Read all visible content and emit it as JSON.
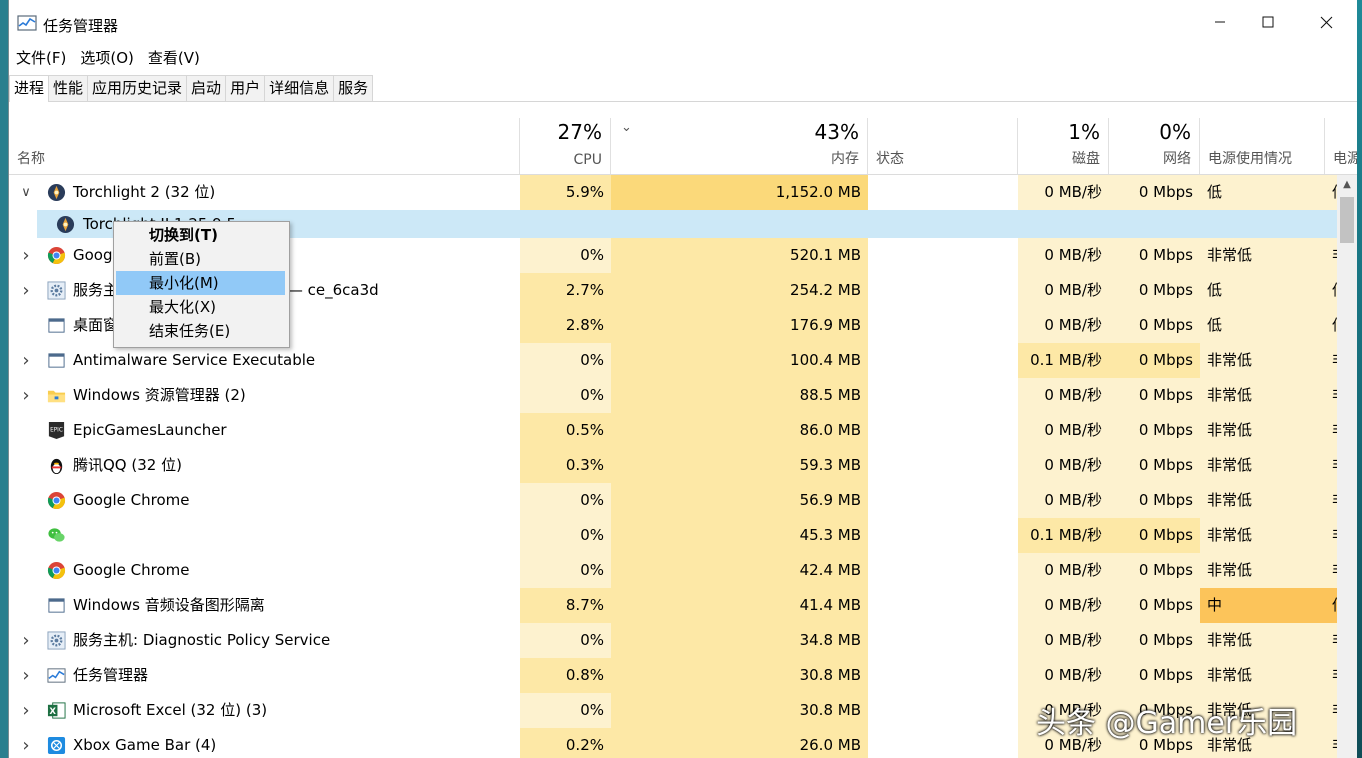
{
  "window": {
    "title": "任务管理器"
  },
  "menu": [
    "文件(F)",
    "选项(O)",
    "查看(V)"
  ],
  "tabs": [
    "进程",
    "性能",
    "应用历史记录",
    "启动",
    "用户",
    "详细信息",
    "服务"
  ],
  "columns": {
    "name": "名称",
    "cpu": {
      "pct": "27%",
      "label": "CPU"
    },
    "mem": {
      "pct": "43%",
      "label": "内存"
    },
    "status": "状态",
    "disk": {
      "pct": "1%",
      "label": "磁盘"
    },
    "net": {
      "pct": "0%",
      "label": "网络"
    },
    "power": "电源使用情况",
    "power_trend": "电源"
  },
  "processes": [
    {
      "name": "Torchlight 2 (32 位)",
      "cpu": "5.9%",
      "mem": "1,152.0 MB",
      "disk": "0 MB/秒",
      "net": "0 Mbps",
      "power": "低",
      "trend": "低",
      "icon": "torchlight-icon",
      "expand": "v",
      "color_cpu": "#fde8a6",
      "color_mem": "#fbd97a",
      "color_disk": "#fdf2cf",
      "color_power": "#fdf2cf"
    },
    {
      "name": "Torchlight II 1.25.9.5",
      "cpu": "",
      "mem": "",
      "disk": "",
      "net": "",
      "power": "",
      "trend": "",
      "icon": "torchlight-icon",
      "expand": "",
      "child": true,
      "selected": true
    },
    {
      "name": "Google Chrome",
      "cpu": "0%",
      "mem": "520.1 MB",
      "disk": "0 MB/秒",
      "net": "0 Mbps",
      "power": "非常低",
      "trend": "非常低",
      "icon": "chrome-icon",
      "expand": ">",
      "color_cpu": "#fdf2cf",
      "color_mem": "#fde8a6",
      "color_disk": "#fdf2cf",
      "color_power": "#fdf2cf"
    },
    {
      "name": "服务主机: Unistack 服务组 (3) — ce_6ca3d",
      "cpu": "2.7%",
      "mem": "254.2 MB",
      "disk": "0 MB/秒",
      "net": "0 Mbps",
      "power": "低",
      "trend": "低",
      "icon": "gear-service-icon",
      "expand": ">",
      "color_cpu": "#fde8a6",
      "color_mem": "#fde8a6",
      "color_disk": "#fdf2cf",
      "color_power": "#fdf2cf"
    },
    {
      "name": "桌面窗口管理器",
      "cpu": "2.8%",
      "mem": "176.9 MB",
      "disk": "0 MB/秒",
      "net": "0 Mbps",
      "power": "低",
      "trend": "低",
      "icon": "window-app-icon",
      "expand": "",
      "color_cpu": "#fde8a6",
      "color_mem": "#fde8a6",
      "color_disk": "#fdf2cf",
      "color_power": "#fdf2cf"
    },
    {
      "name": "Antimalware Service Executable",
      "cpu": "0%",
      "mem": "100.4 MB",
      "disk": "0.1 MB/秒",
      "net": "0 Mbps",
      "power": "非常低",
      "trend": "非常低",
      "icon": "window-app-icon",
      "expand": ">",
      "color_cpu": "#fdf2cf",
      "color_mem": "#fde8a6",
      "color_disk": "#fde8a6",
      "color_power": "#fdf2cf"
    },
    {
      "name": "Windows 资源管理器 (2)",
      "cpu": "0%",
      "mem": "88.5 MB",
      "disk": "0 MB/秒",
      "net": "0 Mbps",
      "power": "非常低",
      "trend": "非常低",
      "icon": "folder-icon",
      "expand": ">",
      "color_cpu": "#fdf2cf",
      "color_mem": "#fde8a6",
      "color_disk": "#fdf2cf",
      "color_power": "#fdf2cf"
    },
    {
      "name": "EpicGamesLauncher",
      "cpu": "0.5%",
      "mem": "86.0 MB",
      "disk": "0 MB/秒",
      "net": "0 Mbps",
      "power": "非常低",
      "trend": "非常低",
      "icon": "epic-icon",
      "expand": "",
      "color_cpu": "#fde8a6",
      "color_mem": "#fde8a6",
      "color_disk": "#fdf2cf",
      "color_power": "#fdf2cf"
    },
    {
      "name": "腾讯QQ (32 位)",
      "cpu": "0.3%",
      "mem": "59.3 MB",
      "disk": "0 MB/秒",
      "net": "0 Mbps",
      "power": "非常低",
      "trend": "非常低",
      "icon": "qq-penguin-icon",
      "expand": "",
      "color_cpu": "#fde8a6",
      "color_mem": "#fde8a6",
      "color_disk": "#fdf2cf",
      "color_power": "#fdf2cf"
    },
    {
      "name": "Google Chrome",
      "cpu": "0%",
      "mem": "56.9 MB",
      "disk": "0 MB/秒",
      "net": "0 Mbps",
      "power": "非常低",
      "trend": "非常低",
      "icon": "chrome-icon",
      "expand": "",
      "color_cpu": "#fdf2cf",
      "color_mem": "#fde8a6",
      "color_disk": "#fdf2cf",
      "color_power": "#fdf2cf"
    },
    {
      "name": "",
      "cpu": "0%",
      "mem": "45.3 MB",
      "disk": "0.1 MB/秒",
      "net": "0 Mbps",
      "power": "非常低",
      "trend": "非常低",
      "icon": "wechat-icon",
      "expand": "",
      "color_cpu": "#fdf2cf",
      "color_mem": "#fde8a6",
      "color_disk": "#fde8a6",
      "color_power": "#fdf2cf"
    },
    {
      "name": "Google Chrome",
      "cpu": "0%",
      "mem": "42.4 MB",
      "disk": "0 MB/秒",
      "net": "0 Mbps",
      "power": "非常低",
      "trend": "非常低",
      "icon": "chrome-icon",
      "expand": "",
      "color_cpu": "#fdf2cf",
      "color_mem": "#fde8a6",
      "color_disk": "#fdf2cf",
      "color_power": "#fdf2cf"
    },
    {
      "name": "Windows 音频设备图形隔离",
      "cpu": "8.7%",
      "mem": "41.4 MB",
      "disk": "0 MB/秒",
      "net": "0 Mbps",
      "power": "中",
      "trend": "低",
      "icon": "window-app-icon",
      "expand": "",
      "color_cpu": "#fde8a6",
      "color_mem": "#fde8a6",
      "color_disk": "#fdf2cf",
      "color_power": "#fcc45a"
    },
    {
      "name": "服务主机: Diagnostic Policy Service",
      "cpu": "0%",
      "mem": "34.8 MB",
      "disk": "0 MB/秒",
      "net": "0 Mbps",
      "power": "非常低",
      "trend": "非常低",
      "icon": "gear-service-icon",
      "expand": ">",
      "color_cpu": "#fdf2cf",
      "color_mem": "#fde8a6",
      "color_disk": "#fdf2cf",
      "color_power": "#fdf2cf"
    },
    {
      "name": "任务管理器",
      "cpu": "0.8%",
      "mem": "30.8 MB",
      "disk": "0 MB/秒",
      "net": "0 Mbps",
      "power": "非常低",
      "trend": "非常低",
      "icon": "taskmgr-icon",
      "expand": ">",
      "color_cpu": "#fde8a6",
      "color_mem": "#fde8a6",
      "color_disk": "#fdf2cf",
      "color_power": "#fdf2cf"
    },
    {
      "name": "Microsoft Excel (32 位) (3)",
      "cpu": "0%",
      "mem": "30.8 MB",
      "disk": "0 MB/秒",
      "net": "0 Mbps",
      "power": "非常低",
      "trend": "非常低",
      "icon": "excel-icon",
      "expand": ">",
      "color_cpu": "#fdf2cf",
      "color_mem": "#fde8a6",
      "color_disk": "#fdf2cf",
      "color_power": "#fdf2cf"
    },
    {
      "name": "Xbox Game Bar (4)",
      "cpu": "0.2%",
      "mem": "26.0 MB",
      "disk": "0 MB/秒",
      "net": "0 Mbps",
      "power": "非常低",
      "trend": "非常低",
      "icon": "xbox-icon",
      "expand": ">",
      "color_cpu": "#fde8a6",
      "color_mem": "#fde8a6",
      "color_disk": "#fdf2cf",
      "color_power": "#fdf2cf"
    }
  ],
  "context_menu": {
    "items": [
      "切换到(T)",
      "前置(B)",
      "最小化(M)",
      "最大化(X)",
      "结束任务(E)"
    ],
    "highlighted": "最小化(M)"
  },
  "watermark": "头条 @Gamer乐园"
}
